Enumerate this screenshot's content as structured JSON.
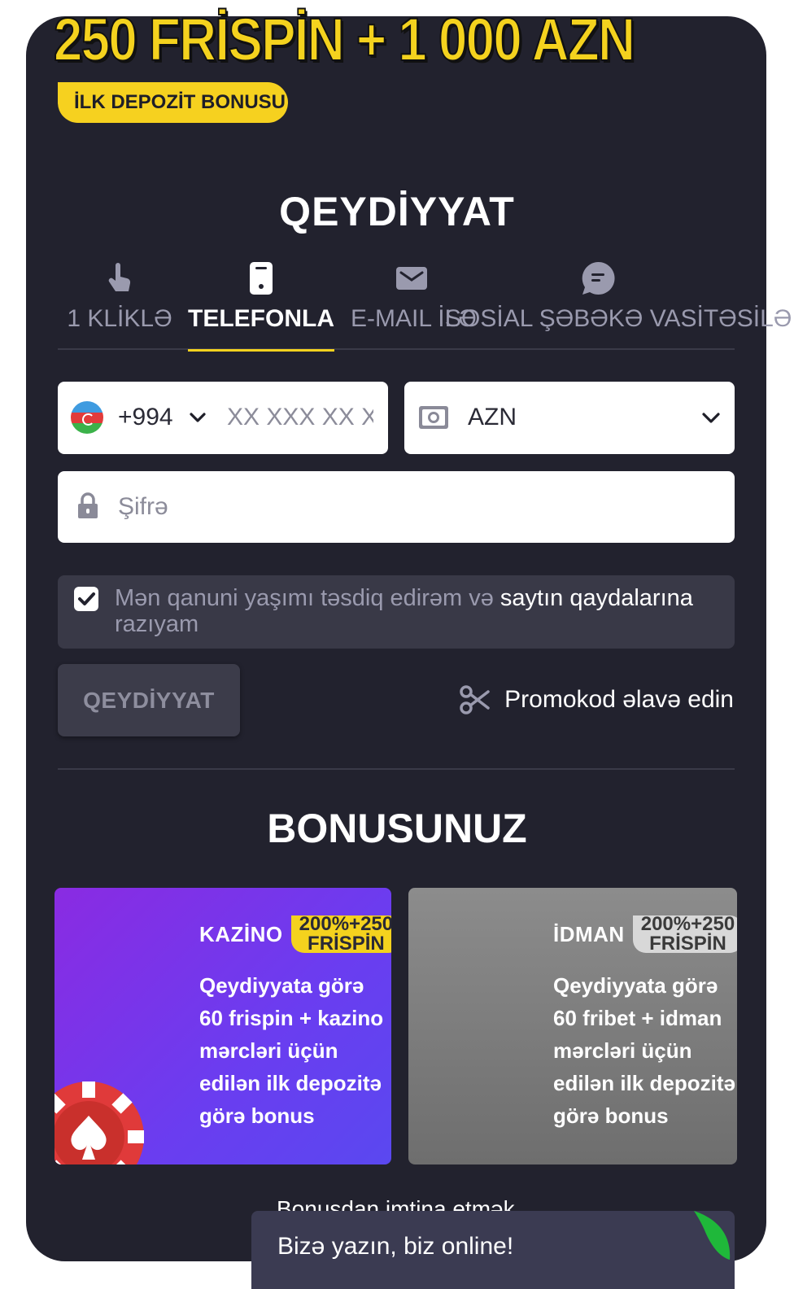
{
  "promo": {
    "headline": "250 FRİSPİN + 1 000 AZN",
    "badge": "İLK DEPOZİT BONUSU"
  },
  "registration": {
    "title": "QEYDİYYAT",
    "tabs": [
      {
        "label": "1 KLİKLƏ",
        "icon": "tap-hand-icon",
        "active": false
      },
      {
        "label": "TELEFONLA",
        "icon": "phone-icon",
        "active": true
      },
      {
        "label": "E-MAIL İLƏ",
        "icon": "mail-icon",
        "active": false
      },
      {
        "label": "SOSİAL ŞƏBƏKƏ VASİTƏSİLƏ",
        "icon": "chat-bubble-icon",
        "active": false
      }
    ],
    "phone": {
      "flag": "azerbaijan-flag-icon",
      "dial_code": "+994",
      "placeholder": "XX XXX XX XX"
    },
    "currency": {
      "icon": "cash-icon",
      "value": "AZN"
    },
    "password": {
      "placeholder": "Şifrə"
    },
    "agree": {
      "checked": true,
      "text": "Mən qanuni yaşımı təsdiq edirəm və ",
      "link": "saytın qaydalarına",
      "text_end": "razıyam"
    },
    "submit_label": "QEYDİYYAT",
    "promocode_label": "Promokod əlavə edin"
  },
  "bonus": {
    "title": "BONUSUNUZ",
    "cards": [
      {
        "category": "KAZİNO",
        "pill_line1": "200%+250",
        "pill_line2": "FRİSPİN",
        "description": "Qeydiyyata görə 60 frispin + kazino mərcləri üçün edilən ilk depozitə görə bonus",
        "selected": true
      },
      {
        "category": "İDMAN",
        "pill_line1": "200%+250",
        "pill_line2": "FRİSPİN",
        "description": "Qeydiyyata görə 60 fribet + idman mərcləri üçün edilən ilk depozitə görə bonus",
        "selected": false
      }
    ],
    "decline_label": "Bonusdan imtina etmək"
  },
  "chat": {
    "label": "Bizə yazın, biz online!"
  },
  "colors": {
    "background": "#22222e",
    "accent": "#f4d21e",
    "casino_purple": "#8a2be2",
    "muted_text": "#9a9aae"
  }
}
